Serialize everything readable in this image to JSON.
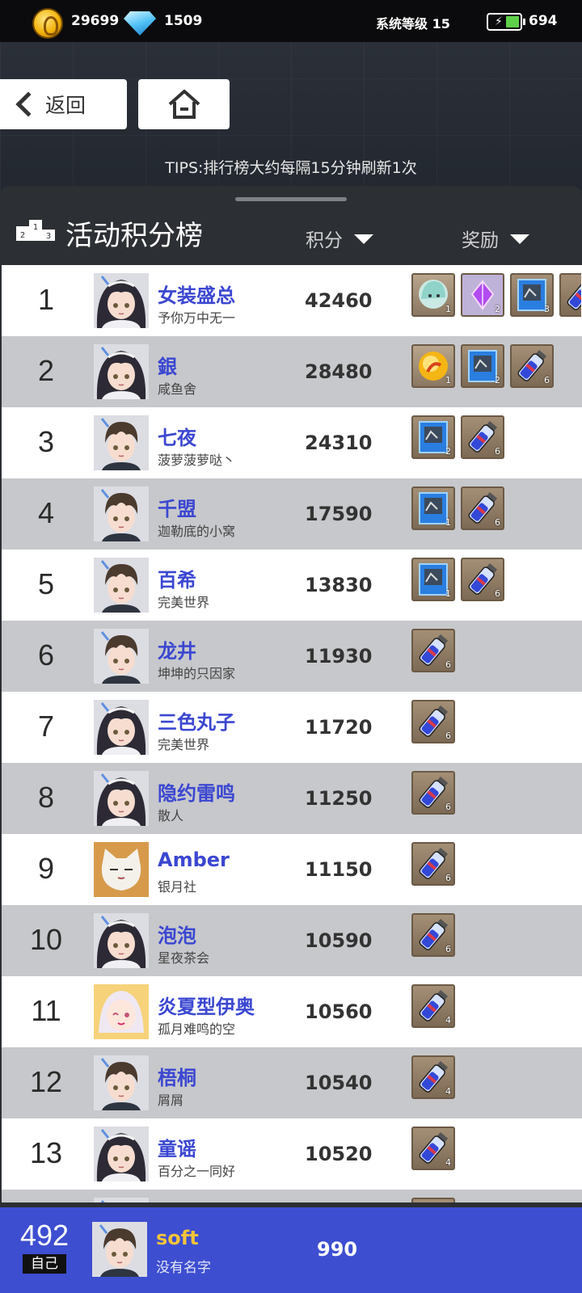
{
  "status_bar": {
    "coins": "29699",
    "gems": "1509",
    "system_level": "系统等级 15",
    "energy": "694"
  },
  "nav": {
    "back_label": "返回",
    "home_icon": "home-icon"
  },
  "tips": "TIPS:排行榜大约每隔15分钟刷新1次",
  "board": {
    "title": "活动积分榜",
    "score_header": "积分",
    "reward_header": "奖励"
  },
  "colors": {
    "name_blue": "#3b47d1",
    "self_bar": "#3d4ed1",
    "self_name": "#f3c33a",
    "row_alt": "#c7c8cb"
  },
  "rows": [
    {
      "rank": "1",
      "name": "女装盛总",
      "guild": "予你万中无一",
      "score": "42460",
      "avatar": "girl-avatar",
      "rewards": [
        {
          "icon": "character-token-icon",
          "count": "1"
        },
        {
          "icon": "purple-crystal-icon",
          "count": "2"
        },
        {
          "icon": "blue-card-icon",
          "count": "3"
        },
        {
          "icon": "potion-icon",
          "count": ""
        }
      ]
    },
    {
      "rank": "2",
      "name": "銀",
      "guild": "咸鱼舍",
      "score": "28480",
      "avatar": "girl-avatar",
      "rewards": [
        {
          "icon": "gold-orb-icon",
          "count": "1"
        },
        {
          "icon": "blue-card-icon",
          "count": "2"
        },
        {
          "icon": "potion-icon",
          "count": "6"
        }
      ]
    },
    {
      "rank": "3",
      "name": "七夜",
      "guild": "菠萝菠萝哒丶",
      "score": "24310",
      "avatar": "boy-avatar",
      "rewards": [
        {
          "icon": "blue-card-icon",
          "count": "2"
        },
        {
          "icon": "potion-icon",
          "count": "6"
        }
      ]
    },
    {
      "rank": "4",
      "name": "千盟",
      "guild": "迦勒底的小窝",
      "score": "17590",
      "avatar": "boy-avatar",
      "rewards": [
        {
          "icon": "blue-card-icon",
          "count": "1"
        },
        {
          "icon": "potion-icon",
          "count": "6"
        }
      ]
    },
    {
      "rank": "5",
      "name": "百希",
      "guild": "完美世界",
      "score": "13830",
      "avatar": "boy-avatar",
      "rewards": [
        {
          "icon": "blue-card-icon",
          "count": "1"
        },
        {
          "icon": "potion-icon",
          "count": "6"
        }
      ]
    },
    {
      "rank": "6",
      "name": "龙井",
      "guild": "坤坤的只因家",
      "score": "11930",
      "avatar": "boy-avatar",
      "rewards": [
        {
          "icon": "potion-icon",
          "count": "6"
        }
      ]
    },
    {
      "rank": "7",
      "name": "三色丸子",
      "guild": "完美世界",
      "score": "11720",
      "avatar": "girl-avatar",
      "rewards": [
        {
          "icon": "potion-icon",
          "count": "6"
        }
      ]
    },
    {
      "rank": "8",
      "name": "隐约雷鸣",
      "guild": "散人",
      "score": "11250",
      "avatar": "girl-avatar",
      "rewards": [
        {
          "icon": "potion-icon",
          "count": "6"
        }
      ]
    },
    {
      "rank": "9",
      "name": "Amber",
      "guild": "银月社",
      "score": "11150",
      "avatar": "cat-avatar",
      "rewards": [
        {
          "icon": "potion-icon",
          "count": "6"
        }
      ]
    },
    {
      "rank": "10",
      "name": "泡泡",
      "guild": "星夜茶会",
      "score": "10590",
      "avatar": "girl-avatar",
      "rewards": [
        {
          "icon": "potion-icon",
          "count": "6"
        }
      ]
    },
    {
      "rank": "11",
      "name": "炎夏型伊奥",
      "guild": "孤月难鸣的空",
      "score": "10560",
      "avatar": "anime-girl-avatar",
      "rewards": [
        {
          "icon": "potion-icon",
          "count": "4"
        }
      ]
    },
    {
      "rank": "12",
      "name": "梧桐",
      "guild": "屑屑",
      "score": "10540",
      "avatar": "boy-avatar",
      "rewards": [
        {
          "icon": "potion-icon",
          "count": "4"
        }
      ]
    },
    {
      "rank": "13",
      "name": "童谣",
      "guild": "百分之一同好",
      "score": "10520",
      "avatar": "girl-avatar",
      "rewards": [
        {
          "icon": "potion-icon",
          "count": "4"
        }
      ]
    },
    {
      "rank": "",
      "name": "",
      "guild": "",
      "score": "",
      "avatar": "girl-avatar",
      "rewards": [
        {
          "icon": "potion-icon",
          "count": ""
        }
      ]
    }
  ],
  "self": {
    "rank": "492",
    "tag": "自己",
    "name": "soft",
    "guild": "没有名字",
    "score": "990",
    "avatar": "boy-avatar"
  }
}
